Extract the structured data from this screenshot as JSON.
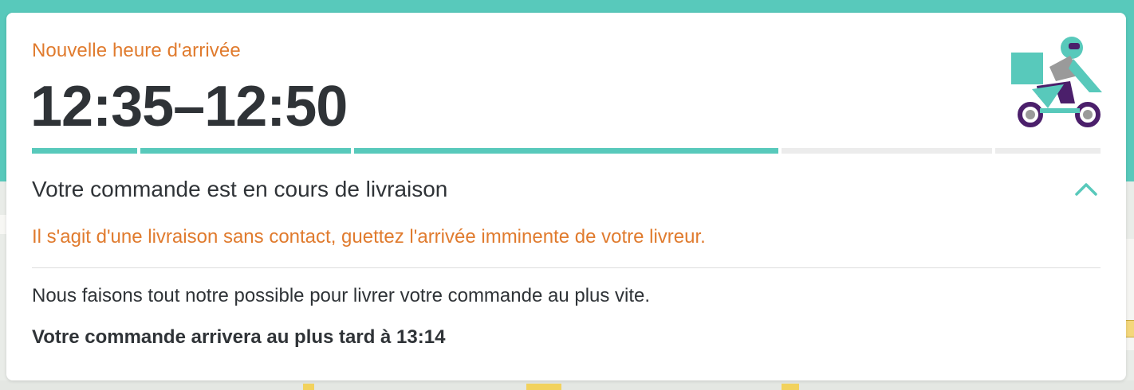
{
  "colors": {
    "accent_teal": "#58c9bb",
    "accent_orange": "#e07b2e",
    "text_dark": "#2f3337",
    "progress_empty": "#ececec",
    "courier_purple": "#4b1f6b"
  },
  "card": {
    "subtitle": "Nouvelle heure d'arrivée",
    "eta": "12:35–12:50",
    "courier_icon": "delivery-scooter-icon"
  },
  "progress": {
    "total_steps": 5,
    "completed_steps": 3
  },
  "status": {
    "title": "Votre commande est en cours de livraison",
    "toggle_icon": "chevron-up-icon",
    "contactless_notice": "Il s'agit d'une livraison sans contact, guettez l'arrivée imminente de votre livreur.",
    "info": "Nous faisons tout notre possible pour livrer votre commande au plus vite.",
    "latest_arrival": "Votre commande arrivera au plus tard à 13:14"
  }
}
